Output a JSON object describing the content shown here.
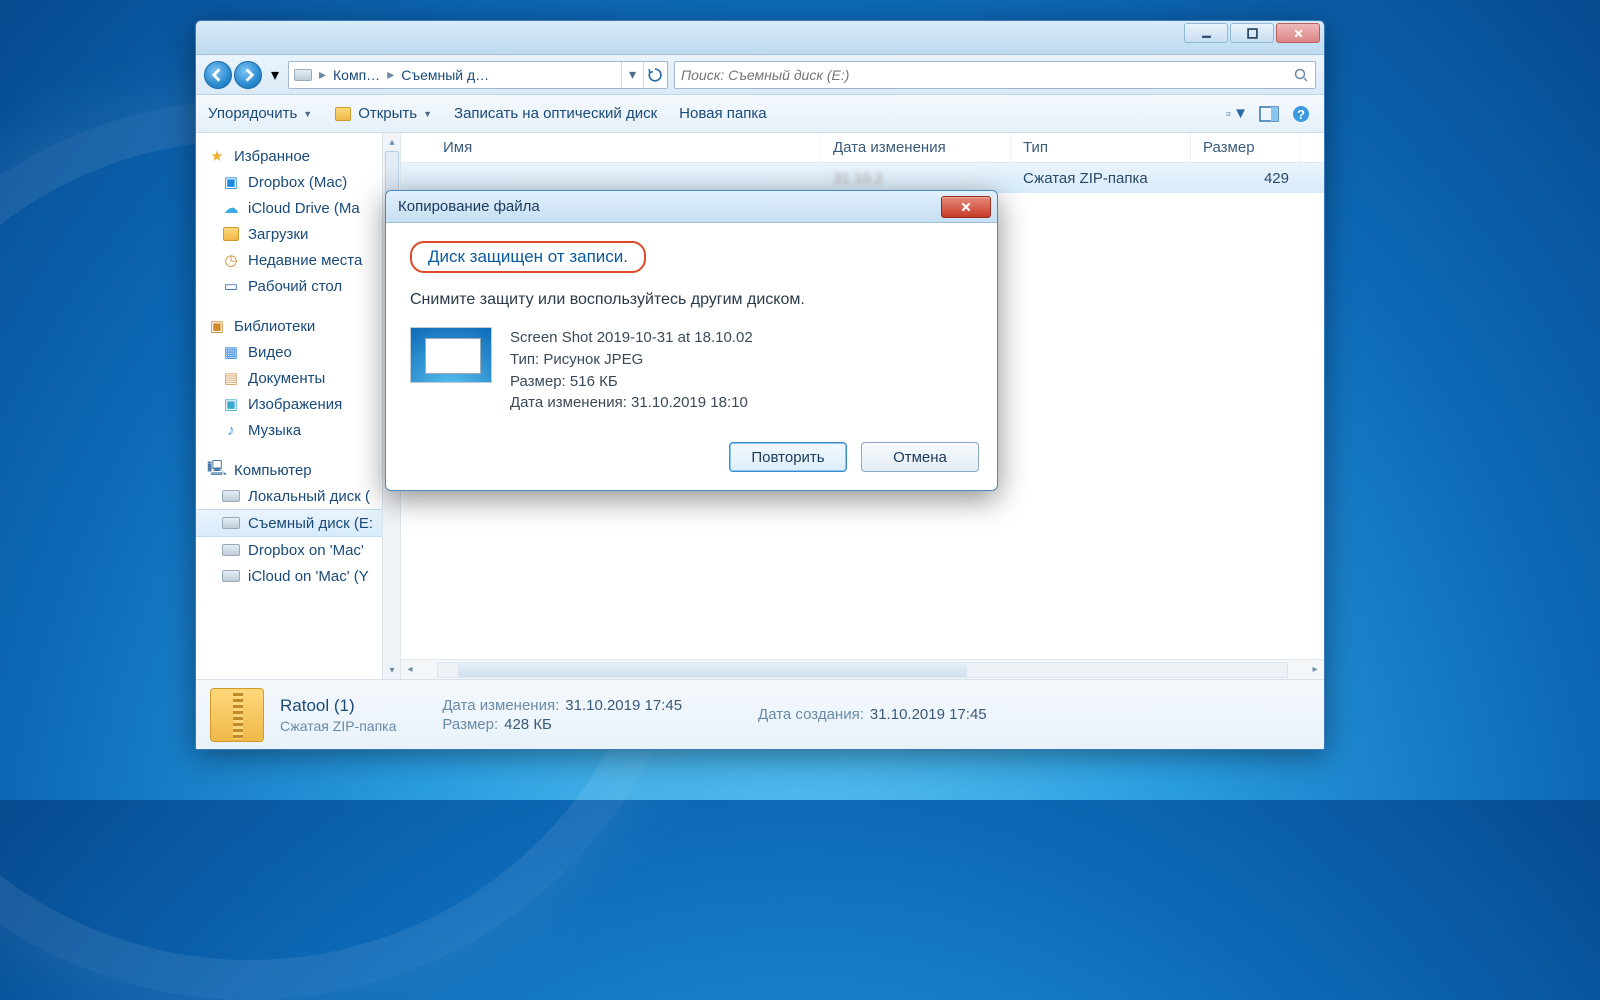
{
  "breadcrumb": {
    "drive_icon": "drive",
    "crumb1": "Комп…",
    "crumb2": "Съемный д…"
  },
  "search": {
    "placeholder": "Поиск: Съемный диск (E:)"
  },
  "toolbar": {
    "organize": "Упорядочить",
    "open": "Открыть",
    "burn": "Записать на оптический диск",
    "new_folder": "Новая папка"
  },
  "sidebar": {
    "favorites": {
      "head": "Избранное",
      "items": [
        "Dropbox (Mac)",
        "iCloud Drive (Ma",
        "Загрузки",
        "Недавние места",
        "Рабочий стол"
      ]
    },
    "libraries": {
      "head": "Библиотеки",
      "items": [
        "Видео",
        "Документы",
        "Изображения",
        "Музыка"
      ]
    },
    "computer": {
      "head": "Компьютер",
      "items": [
        "Локальный диск (",
        "Съемный диск (E:",
        "Dropbox on 'Mac'",
        "iCloud on 'Mac' (Y"
      ]
    }
  },
  "columns": {
    "name": "Имя",
    "modified": "Дата изменения",
    "type": "Тип",
    "size": "Размер"
  },
  "row": {
    "date_blur": "31.10.2",
    "type": "Сжатая ZIP-папка",
    "size": "429"
  },
  "details": {
    "title": "Ratool (1)",
    "subtitle": "Сжатая ZIP-папка",
    "modified_k": "Дата изменения:",
    "modified_v": "31.10.2019 17:45",
    "size_k": "Размер:",
    "size_v": "428 КБ",
    "created_k": "Дата создания:",
    "created_v": "31.10.2019 17:45"
  },
  "dialog": {
    "title": "Копирование файла",
    "headline": "Диск защищен от записи.",
    "subtitle": "Снимите защиту или воспользуйтесь другим диском.",
    "file_name": "Screen Shot 2019-10-31 at 18.10.02",
    "file_type": "Тип: Рисунок JPEG",
    "file_size": "Размер: 516 КБ",
    "file_modified": "Дата изменения: 31.10.2019 18:10",
    "retry": "Повторить",
    "cancel": "Отмена"
  }
}
